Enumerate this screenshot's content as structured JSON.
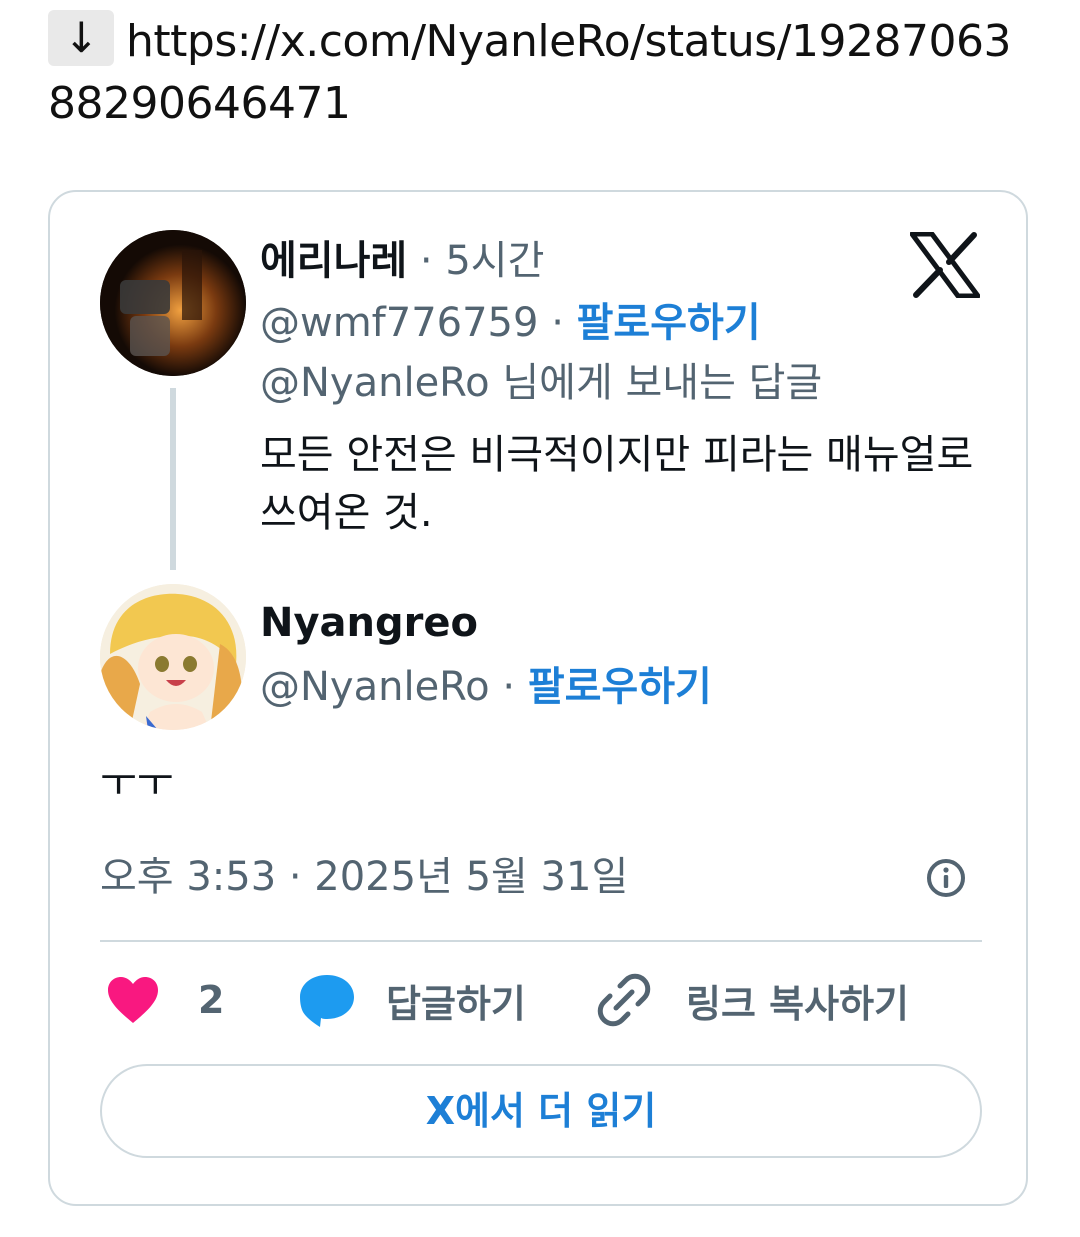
{
  "link": {
    "icon": "down-arrow-icon",
    "glyph": "↓",
    "url": "https://x.com/NyanleRo/status/1928706388290646471"
  },
  "quoted_tweet": {
    "display_name": "에리나레",
    "separator": "·",
    "time_ago": "5시간",
    "handle": "@wmf776759",
    "follow_label": "팔로우하기",
    "reply_to": "@NyanleRo 님에게 보내는 답글",
    "text": "모든 안전은 비극적이지만 피라는 매뉴얼로 쓰여온 것."
  },
  "main_tweet": {
    "display_name": "Nyangreo",
    "handle": "@NyanleRo",
    "separator": "·",
    "follow_label": "팔로우하기",
    "text": "ㅜㅜ",
    "timestamp": "오후 3:53 · 2025년 5월 31일"
  },
  "actions": {
    "like_count": "2",
    "reply_label": "답글하기",
    "copy_link_label": "링크 복사하기"
  },
  "read_more_label": "X에서 더 읽기",
  "colors": {
    "accent_blue": "#1d7fd6",
    "heart_pink": "#f91880",
    "reply_blue": "#1d9bf0",
    "muted_gray": "#536471",
    "border_gray": "#cfd9de"
  }
}
